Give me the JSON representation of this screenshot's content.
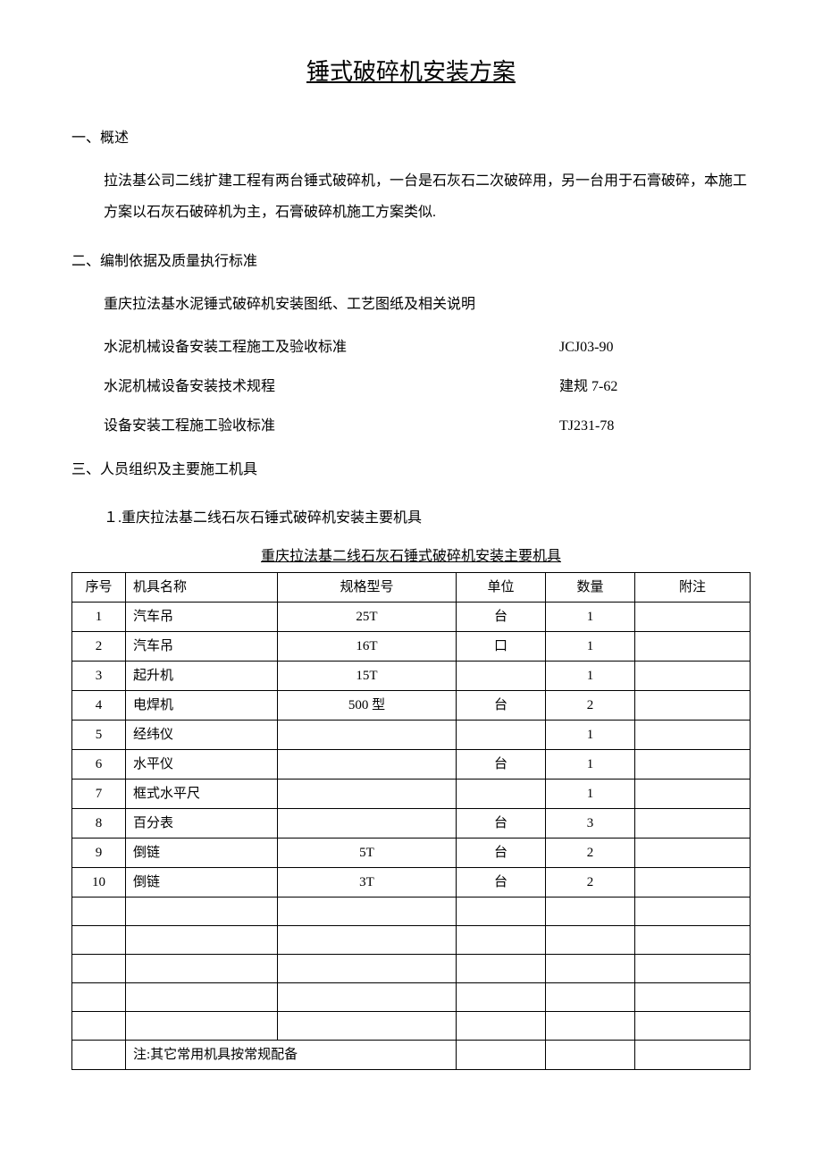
{
  "title": "锤式破碎机安装方案",
  "sections": {
    "s1": {
      "heading": "一、概述",
      "para": "拉法基公司二线扩建工程有两台锤式破碎机，一台是石灰石二次破碎用，另一台用于石膏破碎，本施工方案以石灰石破碎机为主，石膏破碎机施工方案类似."
    },
    "s2": {
      "heading": "二、编制依据及质量执行标准",
      "line1": "重庆拉法基水泥锤式破碎机安装图纸、工艺图纸及相关说明",
      "std1_name": "水泥机械设备安装工程施工及验收标准",
      "std1_code": "JCJ03-90",
      "std2_name": "水泥机械设备安装技术规程",
      "std2_code": "建规 7-62",
      "std3_name": "设备安装工程施工验收标准",
      "std3_code": "TJ231-78"
    },
    "s3": {
      "heading": "三、人员组织及主要施工机具",
      "sub1": "１.重庆拉法基二线石灰石锤式破碎机安装主要机具",
      "table_caption": "重庆拉法基二线石灰石锤式破碎机安装主要机具",
      "headers": {
        "seq": "序号",
        "name": "机具名称",
        "spec": "规格型号",
        "unit": "单位",
        "qty": "数量",
        "note": "附注"
      },
      "rows": [
        {
          "seq": "1",
          "name": "汽车吊",
          "spec": "25T",
          "unit": "台",
          "qty": "1",
          "note": ""
        },
        {
          "seq": "2",
          "name": "汽车吊",
          "spec": "16T",
          "unit": "口",
          "qty": "1",
          "note": ""
        },
        {
          "seq": "3",
          "name": "起升机",
          "spec": "15T",
          "unit": "",
          "qty": "1",
          "note": ""
        },
        {
          "seq": "4",
          "name": "电焊机",
          "spec": "500 型",
          "unit": "台",
          "qty": "2",
          "note": ""
        },
        {
          "seq": "5",
          "name": "经纬仪",
          "spec": "",
          "unit": "",
          "qty": "1",
          "note": ""
        },
        {
          "seq": "6",
          "name": "水平仪",
          "spec": "",
          "unit": "台",
          "qty": "1",
          "note": ""
        },
        {
          "seq": "7",
          "name": "框式水平尺",
          "spec": "",
          "unit": "",
          "qty": "1",
          "note": ""
        },
        {
          "seq": "8",
          "name": "百分表",
          "spec": "",
          "unit": "台",
          "qty": "3",
          "note": ""
        },
        {
          "seq": "9",
          "name": "倒链",
          "spec": "5T",
          "unit": "台",
          "qty": "2",
          "note": ""
        },
        {
          "seq": "10",
          "name": "倒链",
          "spec": "3T",
          "unit": "台",
          "qty": "2",
          "note": ""
        },
        {
          "seq": "",
          "name": "",
          "spec": "",
          "unit": "",
          "qty": "",
          "note": ""
        },
        {
          "seq": "",
          "name": "",
          "spec": "",
          "unit": "",
          "qty": "",
          "note": ""
        },
        {
          "seq": "",
          "name": "",
          "spec": "",
          "unit": "",
          "qty": "",
          "note": ""
        },
        {
          "seq": "",
          "name": "",
          "spec": "",
          "unit": "",
          "qty": "",
          "note": ""
        },
        {
          "seq": "",
          "name": "",
          "spec": "",
          "unit": "",
          "qty": "",
          "note": ""
        }
      ],
      "table_note": "注:其它常用机具按常规配备"
    }
  }
}
